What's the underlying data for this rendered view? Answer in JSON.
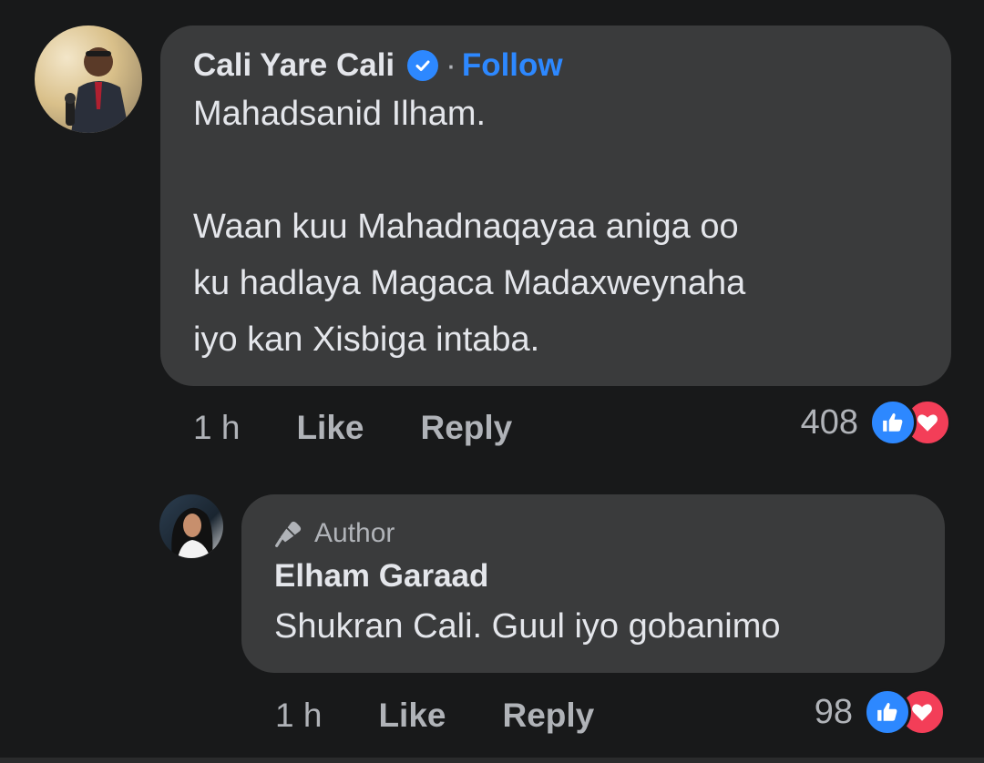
{
  "comment": {
    "author": "Cali Yare Cali",
    "separator": "·",
    "follow_label": "Follow",
    "line1": "Mahadsanid Ilham.",
    "para2": [
      "Waan kuu Mahadnaqayaa aniga oo",
      "ku hadlaya Magaca Madaxweynaha",
      "iyo kan Xisbiga intaba."
    ],
    "time": "1 h",
    "like_label": "Like",
    "reply_label": "Reply",
    "reaction_count": "408"
  },
  "reply": {
    "badge": "Author",
    "author": "Elham Garaad",
    "text": "Shukran Cali. Guul iyo gobanimo",
    "time": "1 h",
    "like_label": "Like",
    "reply_label": "Reply",
    "reaction_count": "98"
  },
  "colors": {
    "background": "#18191a",
    "bubble": "#3a3b3c",
    "accent": "#2d88ff",
    "love": "#f33e58",
    "secondary_text": "#b0b3b8"
  },
  "icons": [
    "verified-badge-icon",
    "like-reaction-icon",
    "love-reaction-icon",
    "microphone-icon"
  ]
}
